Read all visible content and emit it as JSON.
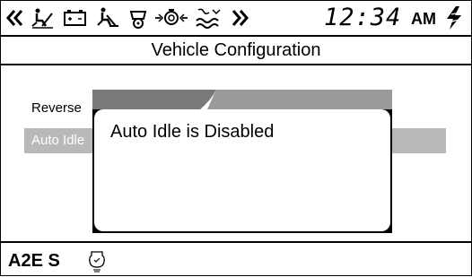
{
  "status_bar": {
    "icons": [
      "chevron-left-icon",
      "parking-brake-icon",
      "battery-icon",
      "hill-start-icon",
      "brake-icon",
      "engine-icon",
      "fluid-icon",
      "chevron-right-icon"
    ],
    "time": "12:34",
    "ampm": "AM",
    "bolt_icon": "lightning-bolt-icon"
  },
  "title": "Vehicle Configuration",
  "menu": {
    "items": [
      {
        "label": "Reverse",
        "selected": false
      },
      {
        "label": "Auto Idle",
        "selected": true
      }
    ]
  },
  "dialog": {
    "message": "Auto Idle is Disabled"
  },
  "bottom_bar": {
    "label": "A2E S",
    "icon": "auto-idle-icon"
  },
  "colors": {
    "selection_bg": "#b9b9b9",
    "foreground": "#000000",
    "background": "#ffffff"
  }
}
